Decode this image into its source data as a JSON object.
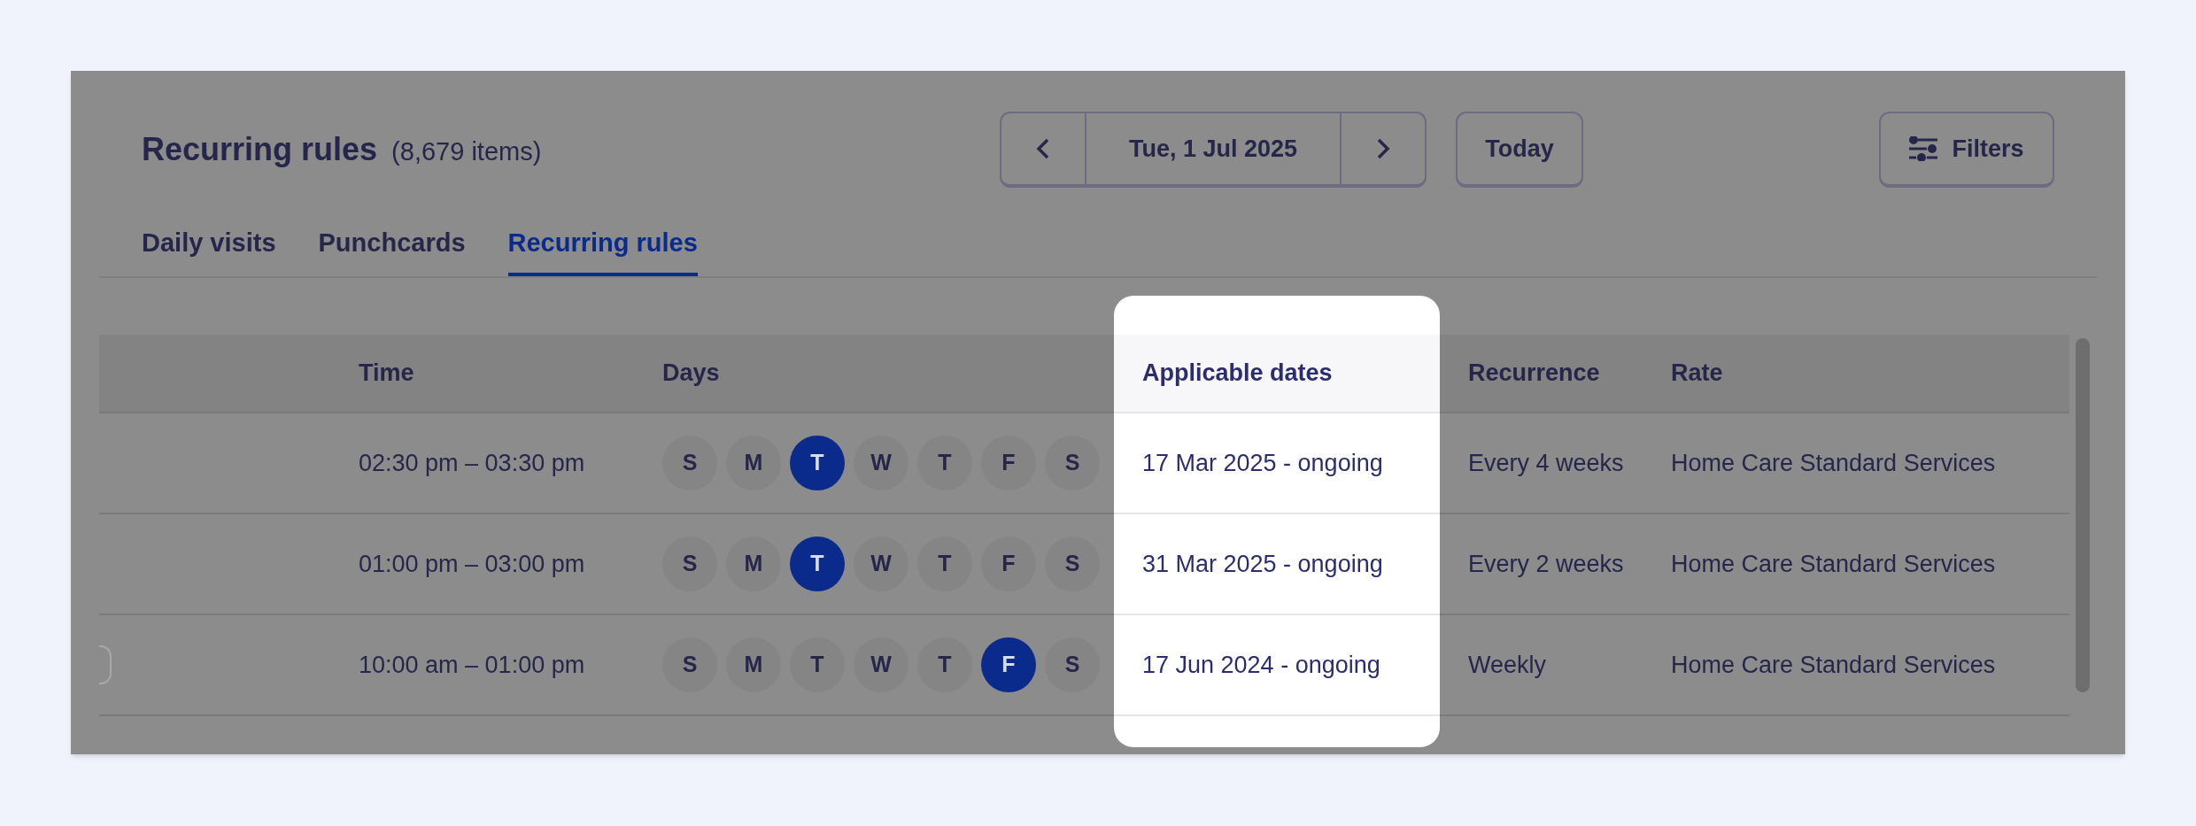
{
  "header": {
    "title": "Recurring rules",
    "count": "(8,679 items)"
  },
  "date_nav": {
    "date": "Tue, 1 Jul 2025"
  },
  "today_button": "Today",
  "filters_button": "Filters",
  "tabs": [
    {
      "label": "Daily visits",
      "selected": false
    },
    {
      "label": "Punchcards",
      "selected": false
    },
    {
      "label": "Recurring rules",
      "selected": true
    }
  ],
  "table": {
    "columns": [
      {
        "label": "Time",
        "highlighted": false
      },
      {
        "label": "Days",
        "highlighted": false
      },
      {
        "label": "Applicable dates",
        "highlighted": true
      },
      {
        "label": "Recurrence",
        "highlighted": false
      },
      {
        "label": "Rate",
        "highlighted": false
      }
    ],
    "rows": [
      {
        "chip": false,
        "time": "02:30 pm – 03:30 pm",
        "days": [
          {
            "letter": "S",
            "selected": false
          },
          {
            "letter": "M",
            "selected": false
          },
          {
            "letter": "T",
            "selected": true
          },
          {
            "letter": "W",
            "selected": false
          },
          {
            "letter": "T",
            "selected": false
          },
          {
            "letter": "F",
            "selected": false
          },
          {
            "letter": "S",
            "selected": false
          }
        ],
        "applicable_dates": "17 Mar 2025 - ongoing",
        "recurrence": "Every 4 weeks",
        "rate": "Home Care Standard Services"
      },
      {
        "chip": false,
        "time": "01:00 pm – 03:00 pm",
        "days": [
          {
            "letter": "S",
            "selected": false
          },
          {
            "letter": "M",
            "selected": false
          },
          {
            "letter": "T",
            "selected": true
          },
          {
            "letter": "W",
            "selected": false
          },
          {
            "letter": "T",
            "selected": false
          },
          {
            "letter": "F",
            "selected": false
          },
          {
            "letter": "S",
            "selected": false
          }
        ],
        "applicable_dates": "31 Mar 2025 - ongoing",
        "recurrence": "Every 2 weeks",
        "rate": "Home Care Standard Services"
      },
      {
        "chip": true,
        "time": "10:00 am – 01:00 pm",
        "days": [
          {
            "letter": "S",
            "selected": false
          },
          {
            "letter": "M",
            "selected": false
          },
          {
            "letter": "T",
            "selected": false
          },
          {
            "letter": "W",
            "selected": false
          },
          {
            "letter": "T",
            "selected": false
          },
          {
            "letter": "F",
            "selected": true
          },
          {
            "letter": "S",
            "selected": false
          }
        ],
        "applicable_dates": "17 Jun 2024 - ongoing",
        "recurrence": "Weekly",
        "rate": "Home Care Standard Services"
      }
    ]
  }
}
